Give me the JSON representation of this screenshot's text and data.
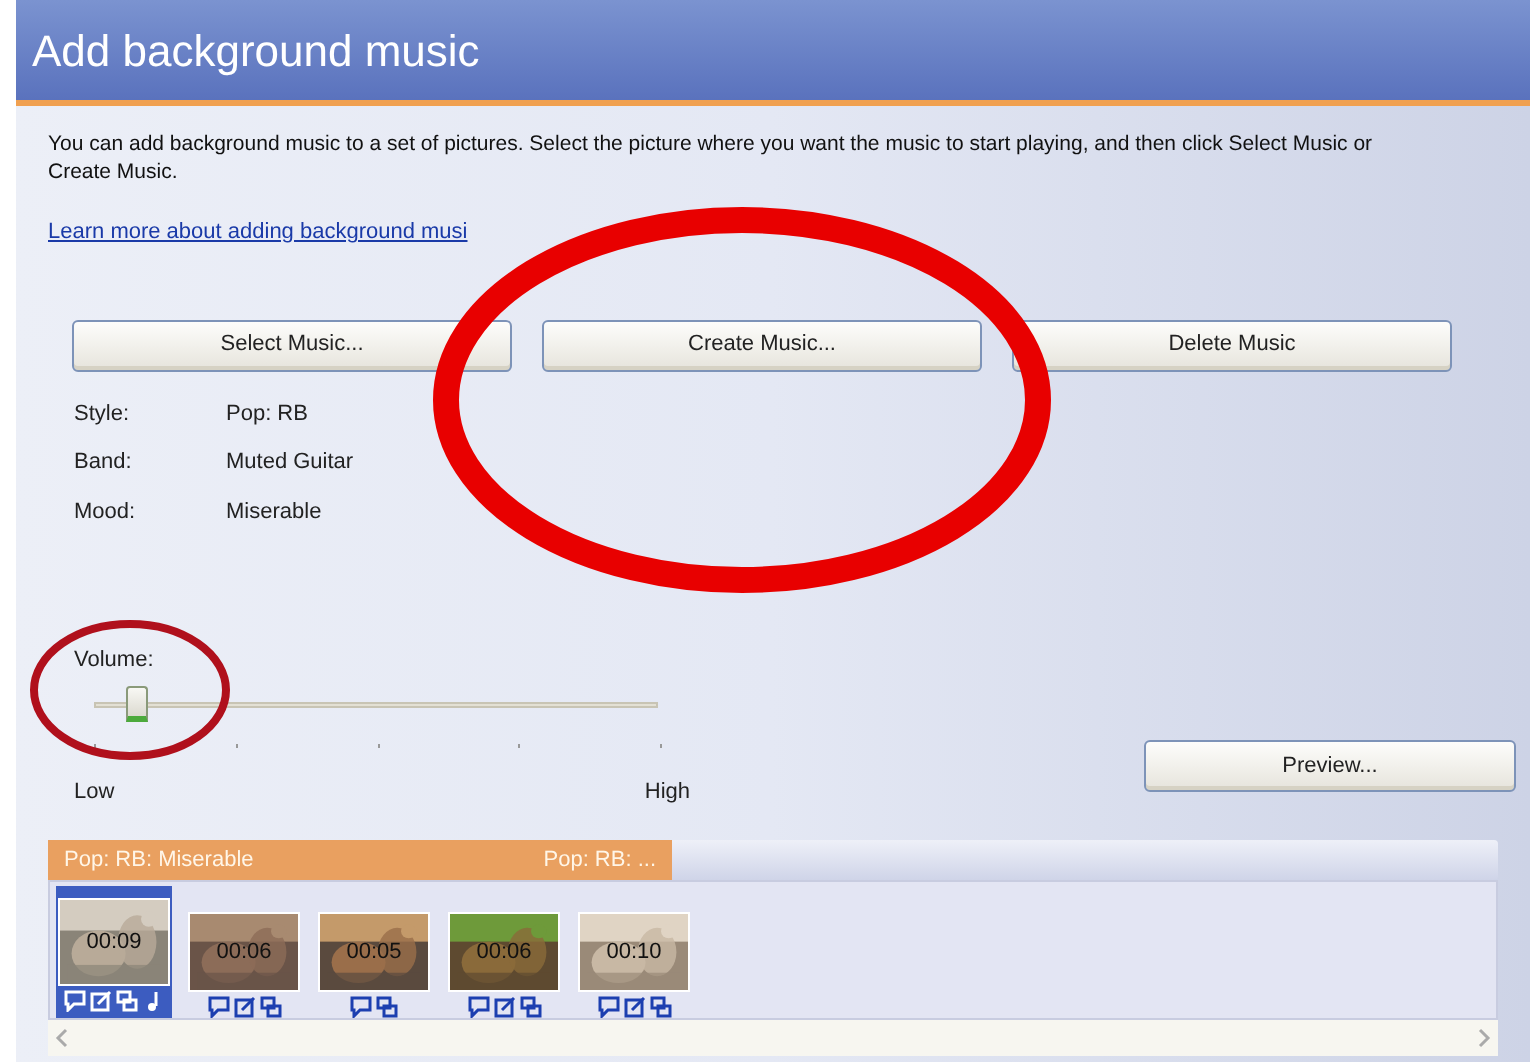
{
  "window": {
    "title": "Add background music"
  },
  "intro": "You can add background music to a set of pictures.  Select the picture where you want the music to start playing, and then click Select Music or Create Music.",
  "learn_more_link": "Learn more about adding background musi",
  "buttons": [
    "Select Music...",
    "Create Music...",
    "Delete Music"
  ],
  "details": [
    {
      "label": "Style:",
      "value": "Pop: RB"
    },
    {
      "label": "Band:",
      "value": "Muted Guitar"
    },
    {
      "label": "Mood:",
      "value": "Miserable"
    }
  ],
  "volume": {
    "label": "Volume:",
    "level": 0.07,
    "min_label": "Low",
    "max_label": "High"
  },
  "preview_button": "Preview...",
  "music_track": {
    "segments": [
      "Pop: RB: Miserable",
      "Pop: RB: ..."
    ]
  },
  "pictures": [
    {
      "duration": "00:09",
      "selected": true,
      "icons": [
        {
          "kind": "note"
        },
        {
          "kind": "edit"
        },
        {
          "kind": "transition"
        },
        {
          "kind": "music"
        }
      ]
    },
    {
      "duration": "00:06",
      "selected": false,
      "icons": [
        {
          "kind": "note"
        },
        {
          "kind": "edit"
        },
        {
          "kind": "transition"
        }
      ]
    },
    {
      "duration": "00:05",
      "selected": false,
      "icons": [
        {
          "kind": "note"
        },
        {
          "kind": "transition"
        }
      ]
    },
    {
      "duration": "00:06",
      "selected": false,
      "icons": [
        {
          "kind": "note"
        },
        {
          "kind": "edit"
        },
        {
          "kind": "transition"
        }
      ]
    },
    {
      "duration": "00:10",
      "selected": false,
      "icons": [
        {
          "kind": "note"
        },
        {
          "kind": "edit"
        },
        {
          "kind": "transition"
        }
      ]
    }
  ],
  "annotations": [
    {
      "kind": "ellipse",
      "color": "#e80000"
    },
    {
      "kind": "ellipse",
      "color": "#b0101c"
    }
  ]
}
